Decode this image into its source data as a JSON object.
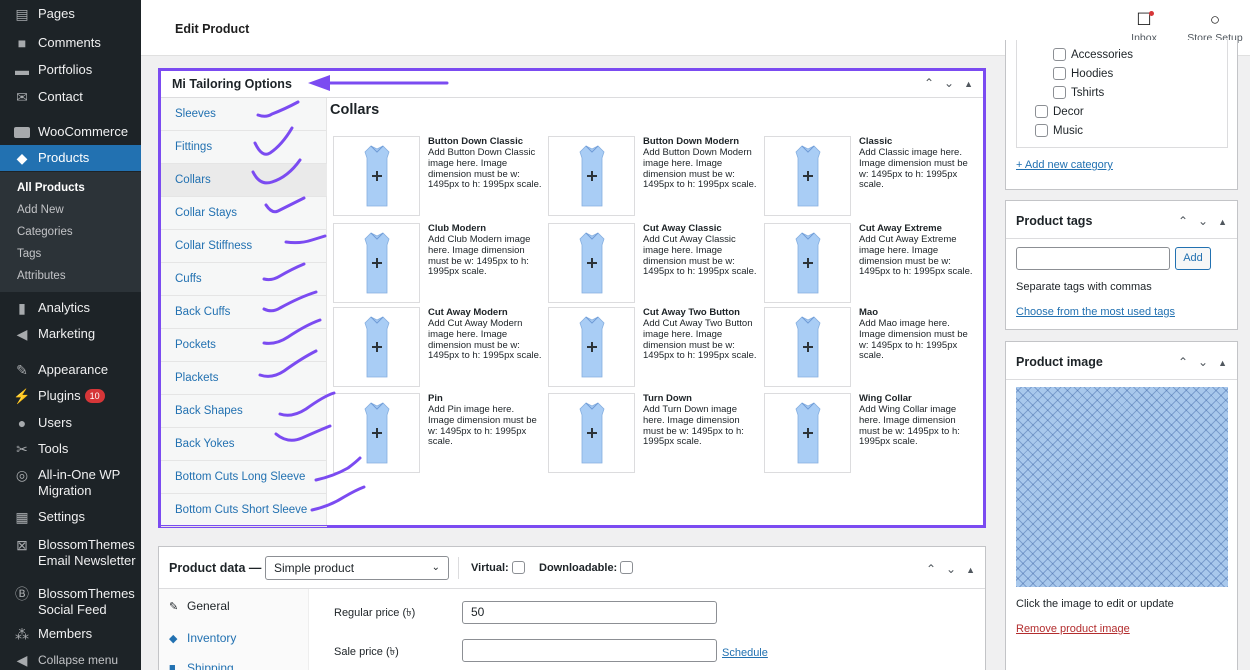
{
  "sidebar": {
    "items": [
      {
        "label": "Pages",
        "icon": "pages-icon"
      },
      {
        "label": "Comments",
        "icon": "comments-icon"
      },
      {
        "label": "Portfolios",
        "icon": "portfolio-icon"
      },
      {
        "label": "Contact",
        "icon": "mail-icon"
      },
      {
        "label": "WooCommerce",
        "icon": "woocommerce-icon"
      },
      {
        "label": "Products",
        "icon": "products-icon"
      },
      {
        "label": "Analytics",
        "icon": "analytics-icon"
      },
      {
        "label": "Marketing",
        "icon": "megaphone-icon"
      },
      {
        "label": "Appearance",
        "icon": "appearance-icon"
      },
      {
        "label": "Plugins",
        "icon": "plugins-icon",
        "badge": "10"
      },
      {
        "label": "Users",
        "icon": "users-icon"
      },
      {
        "label": "Tools",
        "icon": "tools-icon"
      },
      {
        "label": "All-in-One WP Migration",
        "icon": "migration-icon"
      },
      {
        "label": "Settings",
        "icon": "settings-icon"
      },
      {
        "label": "BlossomThemes Email Newsletter",
        "icon": "newsletter-icon"
      },
      {
        "label": "BlossomThemes Social Feed",
        "icon": "social-feed-icon"
      },
      {
        "label": "Members",
        "icon": "members-icon"
      },
      {
        "label": "Collapse menu",
        "icon": "collapse-icon"
      }
    ],
    "submenu": [
      "All Products",
      "Add New",
      "Categories",
      "Tags",
      "Attributes"
    ]
  },
  "topbar": {
    "title": "Edit Product",
    "inbox_label": "Inbox",
    "store_setup_label": "Store Setup"
  },
  "tailoring": {
    "title": "Mi Tailoring Options",
    "tabs": [
      "Sleeves",
      "Fittings",
      "Collars",
      "Collar Stays",
      "Collar Stiffness",
      "Cuffs",
      "Back Cuffs",
      "Pockets",
      "Plackets",
      "Back Shapes",
      "Back Yokes",
      "Bottom Cuts Long Sleeve",
      "Bottom Cuts Short Sleeve"
    ],
    "active_tab": "Collars",
    "section_title": "Collars",
    "options": [
      {
        "name": "Button Down Classic",
        "desc": "Add Button Down Classic image here. Image dimension must be w: 1495px to h: 1995px scale."
      },
      {
        "name": "Button Down Modern",
        "desc": "Add Button Down Modern image here. Image dimension must be w: 1495px to h: 1995px scale."
      },
      {
        "name": "Classic",
        "desc": "Add Classic image here. Image dimension must be w: 1495px to h: 1995px scale."
      },
      {
        "name": "Club Modern",
        "desc": "Add Club Modern image here. Image dimension must be w: 1495px to h: 1995px scale."
      },
      {
        "name": "Cut Away Classic",
        "desc": "Add Cut Away Classic image here. Image dimension must be w: 1495px to h: 1995px scale."
      },
      {
        "name": "Cut Away Extreme",
        "desc": "Add Cut Away Extreme image here. Image dimension must be w: 1495px to h: 1995px scale."
      },
      {
        "name": "Cut Away Modern",
        "desc": "Add Cut Away Modern image here. Image dimension must be w: 1495px to h: 1995px scale."
      },
      {
        "name": "Cut Away Two Button",
        "desc": "Add Cut Away Two Button image here. Image dimension must be w: 1495px to h: 1995px scale."
      },
      {
        "name": "Mao",
        "desc": "Add Mao image here. Image dimension must be w: 1495px to h: 1995px scale."
      },
      {
        "name": "Pin",
        "desc": "Add Pin image here. Image dimension must be w: 1495px to h: 1995px scale."
      },
      {
        "name": "Turn Down",
        "desc": "Add Turn Down image here. Image dimension must be w: 1495px to h: 1995px scale."
      },
      {
        "name": "Wing Collar",
        "desc": "Add Wing Collar image here. Image dimension must be w: 1495px to h: 1995px scale."
      }
    ]
  },
  "product_data": {
    "title": "Product data —",
    "type_value": "Simple product",
    "virtual_label": "Virtual:",
    "downloadable_label": "Downloadable:",
    "tabs": [
      "General",
      "Inventory",
      "Shipping"
    ],
    "regular_price_label": "Regular price (৳)",
    "regular_price_value": "50",
    "sale_price_label": "Sale price (৳)",
    "sale_price_value": "",
    "schedule_label": "Schedule"
  },
  "categories": {
    "items": [
      {
        "label": "Accessories",
        "level": 1
      },
      {
        "label": "Hoodies",
        "level": 1
      },
      {
        "label": "Tshirts",
        "level": 1
      },
      {
        "label": "Decor",
        "level": 0
      },
      {
        "label": "Music",
        "level": 0
      }
    ],
    "add_link": "+ Add new category"
  },
  "tags": {
    "title": "Product tags",
    "add_label": "Add",
    "hint": "Separate tags with commas",
    "link": "Choose from the most used tags"
  },
  "product_image": {
    "title": "Product image",
    "hint": "Click the image to edit or update",
    "remove_label": "Remove product image"
  },
  "colors": {
    "sidebar_bg": "#1d2327",
    "accent": "#2271b1",
    "annotation": "#7b4bf1",
    "shirt": "#a9cdf5"
  }
}
